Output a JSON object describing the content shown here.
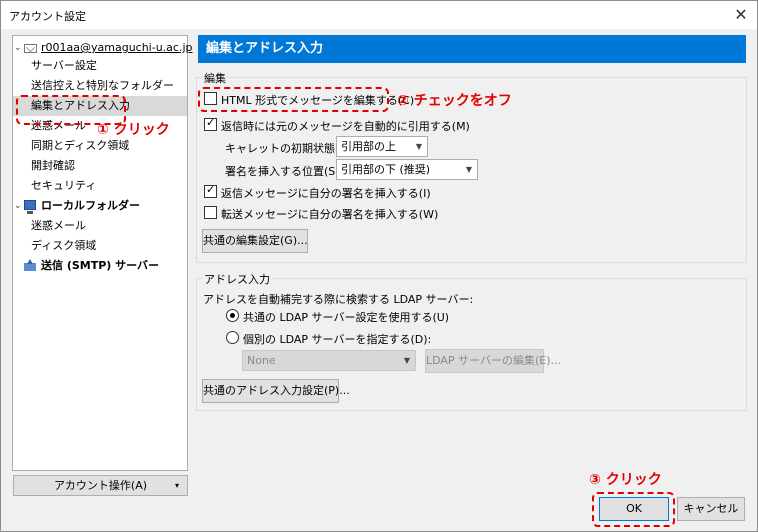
{
  "window": {
    "title": "アカウント設定",
    "close_glyph": "✕"
  },
  "tree": {
    "account": "r001aa@yamaguchi-u.ac.jp",
    "items": [
      "サーバー設定",
      "送信控えと特別なフォルダー",
      "編集とアドレス入力",
      "迷惑メール",
      "同期とディスク領域",
      "開封確認",
      "セキュリティ"
    ],
    "local_folders": "ローカルフォルダー",
    "local_items": [
      "迷惑メール",
      "ディスク領域"
    ],
    "smtp": "送信 (SMTP) サーバー"
  },
  "account_actions": {
    "label": "アカウント操作(A)",
    "arrow": "▾"
  },
  "panel": {
    "title": "編集とアドレス入力",
    "compose": {
      "legend": "編集",
      "html_compose": {
        "label": "HTML 形式でメッセージを編集する(C)",
        "checked": false
      },
      "auto_quote": {
        "label": "返信時には元のメッセージを自動的に引用する(M)",
        "checked": true
      },
      "caret_label": "キャレットの初期状態(T):",
      "caret_value": "引用部の上",
      "sig_label": "署名を挿入する位置(S):",
      "sig_value": "引用部の下 (推奨)",
      "sig_reply": {
        "label": "返信メッセージに自分の署名を挿入する(I)",
        "checked": true
      },
      "sig_forward": {
        "label": "転送メッセージに自分の署名を挿入する(W)",
        "checked": false
      },
      "global_btn": "共通の編集設定(G)..."
    },
    "addressing": {
      "legend": "アドレス入力",
      "desc": "アドレスを自動補完する際に検索する LDAP サーバー:",
      "use_global": {
        "label": "共通の LDAP サーバー設定を使用する(U)",
        "checked": true
      },
      "use_custom": {
        "label": "個別の LDAP サーバーを指定する(D):",
        "checked": false
      },
      "ldap_select": "None",
      "ldap_edit_btn": "LDAP サーバーの編集(E)...",
      "global_btn": "共通のアドレス入力設定(P)..."
    }
  },
  "footer": {
    "ok": "OK",
    "cancel": "キャンセル"
  },
  "annotations": {
    "step1": "① クリック",
    "step2": "② チェックをオフ",
    "step3": "③ クリック",
    "color": "#e00000"
  },
  "colors": {
    "accent": "#0078d7",
    "selected": "#d9d9d9"
  }
}
